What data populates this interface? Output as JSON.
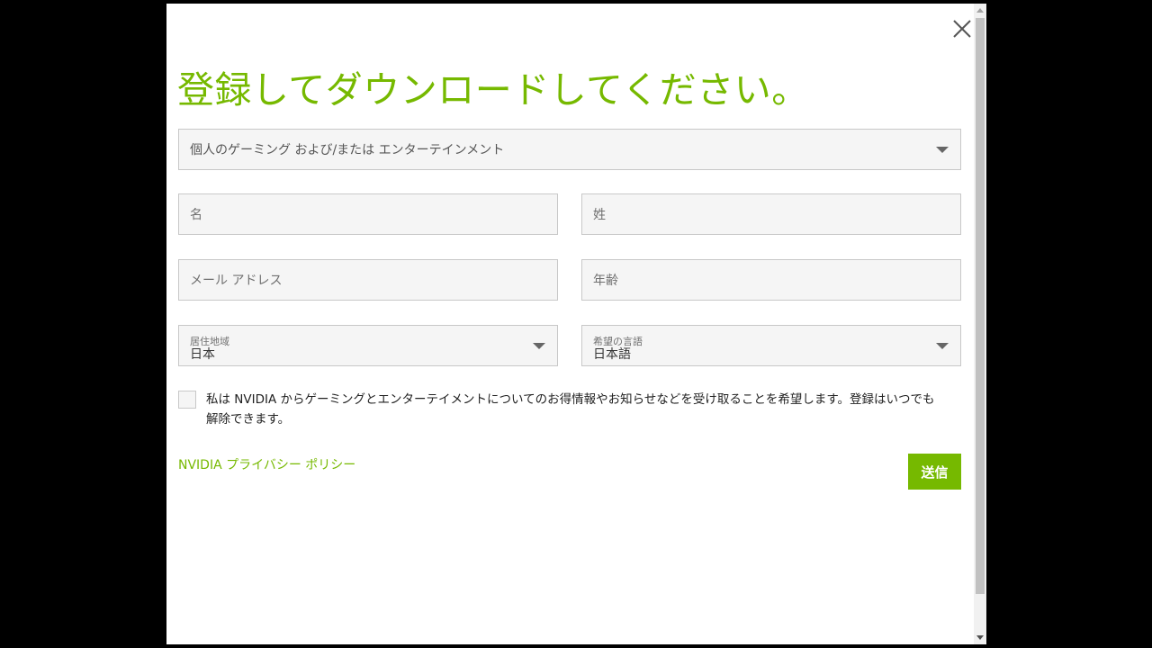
{
  "modal": {
    "title": "登録してダウンロードしてください。",
    "close_icon": "close-icon"
  },
  "form": {
    "interest": {
      "value": "個人のゲーミング および/または エンターテインメント"
    },
    "first_name": {
      "placeholder": "名"
    },
    "last_name": {
      "placeholder": "姓"
    },
    "email": {
      "placeholder": "メール アドレス"
    },
    "age": {
      "placeholder": "年齢"
    },
    "country": {
      "label": "居住地域",
      "value": "日本"
    },
    "language": {
      "label": "希望の言語",
      "value": "日本語"
    },
    "consent_text": "私は NVIDIA からゲーミングとエンターテイメントについてのお得情報やお知らせなどを受け取ることを希望します。登録はいつでも解除できます。",
    "privacy_link": "NVIDIA プライバシー ポリシー",
    "submit_label": "送信"
  },
  "colors": {
    "accent": "#76b900",
    "field_bg": "#f5f5f5",
    "field_border": "#c8c8c8",
    "backdrop": "#000000"
  }
}
